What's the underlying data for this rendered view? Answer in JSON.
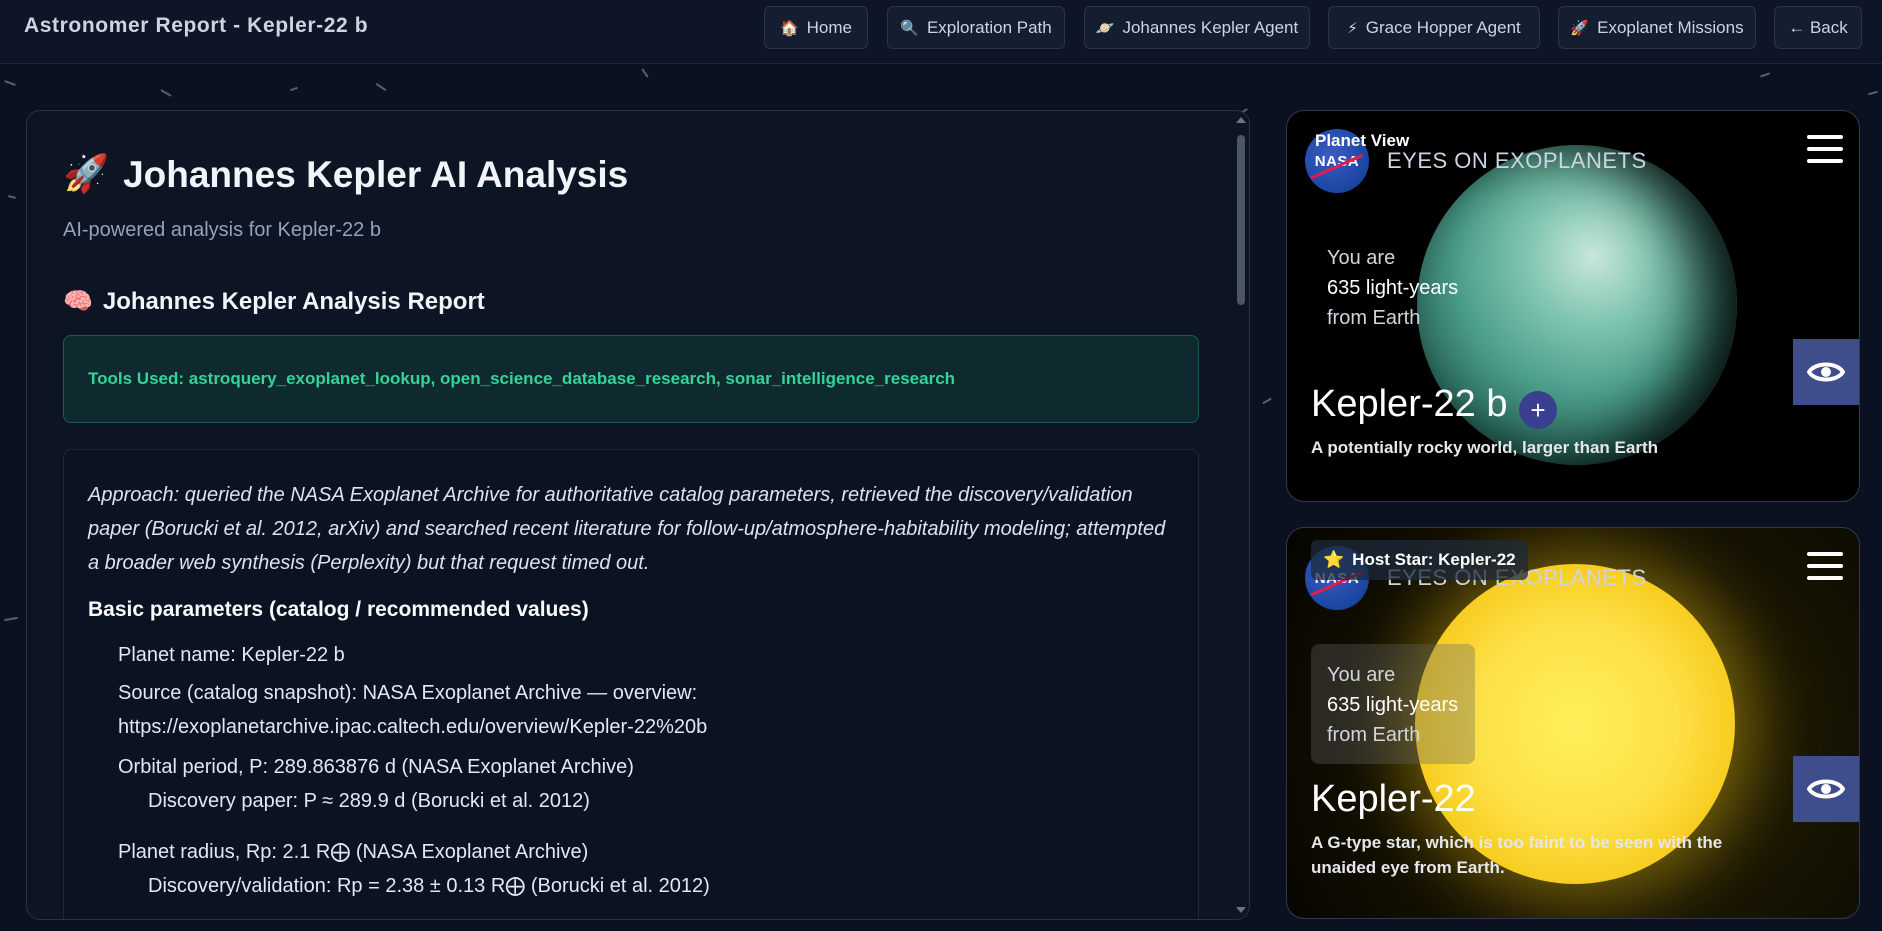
{
  "header": {
    "app_title": "Astronomer Report - Kepler-22 b",
    "nav": [
      {
        "label": "Home",
        "icon": "🏠",
        "icon_name": "home-icon"
      },
      {
        "label": "Exploration Path",
        "icon": "🔍",
        "icon_name": "search-icon"
      },
      {
        "label": "Johannes Kepler Agent",
        "icon": "🪐",
        "icon_name": "planet-icon"
      },
      {
        "label": "Grace Hopper Agent",
        "icon": "⚡",
        "icon_name": "lightning-icon"
      },
      {
        "label": "Exoplanet Missions",
        "icon": "🚀",
        "icon_name": "rocket-icon"
      },
      {
        "label": "← Back",
        "icon": "",
        "icon_name": ""
      }
    ]
  },
  "analysis": {
    "title": "Johannes Kepler AI Analysis",
    "title_icon": "🚀",
    "subtitle": "AI-powered analysis for Kepler-22 b",
    "report_heading": "Johannes Kepler Analysis Report",
    "report_icon": "🧠",
    "tools_used": "Tools Used: astroquery_exoplanet_lookup, open_science_database_research, sonar_intelligence_research",
    "approach": "Approach: queried the NASA Exoplanet Archive for authoritative catalog parameters, retrieved the discovery/validation paper (Borucki et al. 2012, arXiv) and searched recent literature for follow-up/atmosphere-habitability modeling; attempted a broader web synthesis (Perplexity) but that request timed out.",
    "basic_heading": "Basic parameters (catalog / recommended values)",
    "params": {
      "planet_name": "Planet name: Kepler-22 b",
      "source_1": "Source (catalog snapshot): NASA Exoplanet Archive — overview:",
      "source_2": "https://exoplanetarchive.ipac.caltech.edu/overview/Kepler-22%20b",
      "period": "Orbital period, P: 289.863876 d (NASA Exoplanet Archive)",
      "period_disc": "Discovery paper: P ≈ 289.9 d (Borucki et al. 2012)",
      "radius": "Planet radius, Rp: 2.1 R⨁ (NASA Exoplanet Archive)",
      "radius_disc": "Discovery/validation: Rp = 2.38 ± 0.13 R⨁ (Borucki et al. 2012)"
    }
  },
  "planet_card": {
    "view_label": "Planet View",
    "brand": "EYES ON EXOPLANETS",
    "logo_text": "NASA",
    "you_are": "You are",
    "distance": "635 light-years",
    "from": "from Earth",
    "name": "Kepler-22 b",
    "add": "+",
    "description": "A potentially rocky world, larger than Earth"
  },
  "star_card": {
    "view_label": "Host Star: Kepler-22",
    "view_icon": "⭐",
    "brand": "EYES ON EXOPLANETS",
    "logo_text": "NASA",
    "you_are": "You are",
    "distance": "635 light-years",
    "from": "from Earth",
    "name": "Kepler-22",
    "description": "A G-type star, which is too faint to be seen with the unaided eye from Earth."
  }
}
